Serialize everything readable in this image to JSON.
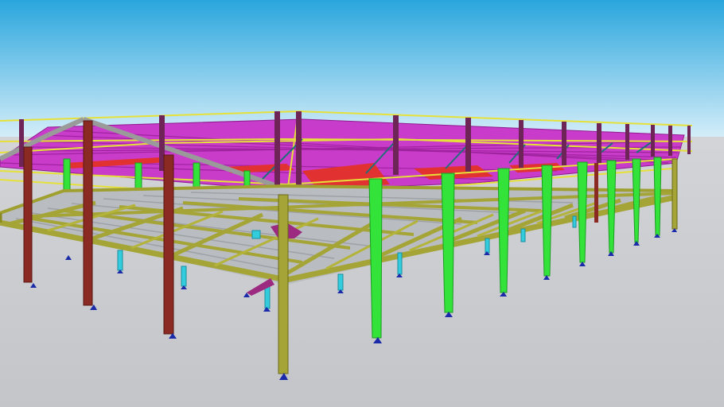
{
  "scene": {
    "description_visible_text": [],
    "colors": {
      "sky_top": "#2aa6dd",
      "sky_bottom": "#d6eef9",
      "ground": "#c9cbcf",
      "floor_frame": "#8a8a22",
      "floor_frame_light": "#b4b43a",
      "floor_deck": "#b9bcc0",
      "column_green": "#33e33a",
      "column_green_dark": "#1c9c22",
      "column_red": "#8b2a22",
      "column_olive": "#a5a537",
      "column_purple": "#6e2456",
      "stub_cyan": "#33ccdd",
      "base_plate": "#1a2aa8",
      "roof_magenta": "#cc33cc",
      "roof_red": "#e03030",
      "roof_rail_yellow": "#e6e13a",
      "brace_gray": "#9a9a9a",
      "brace_teal": "#1f6f7a"
    }
  }
}
